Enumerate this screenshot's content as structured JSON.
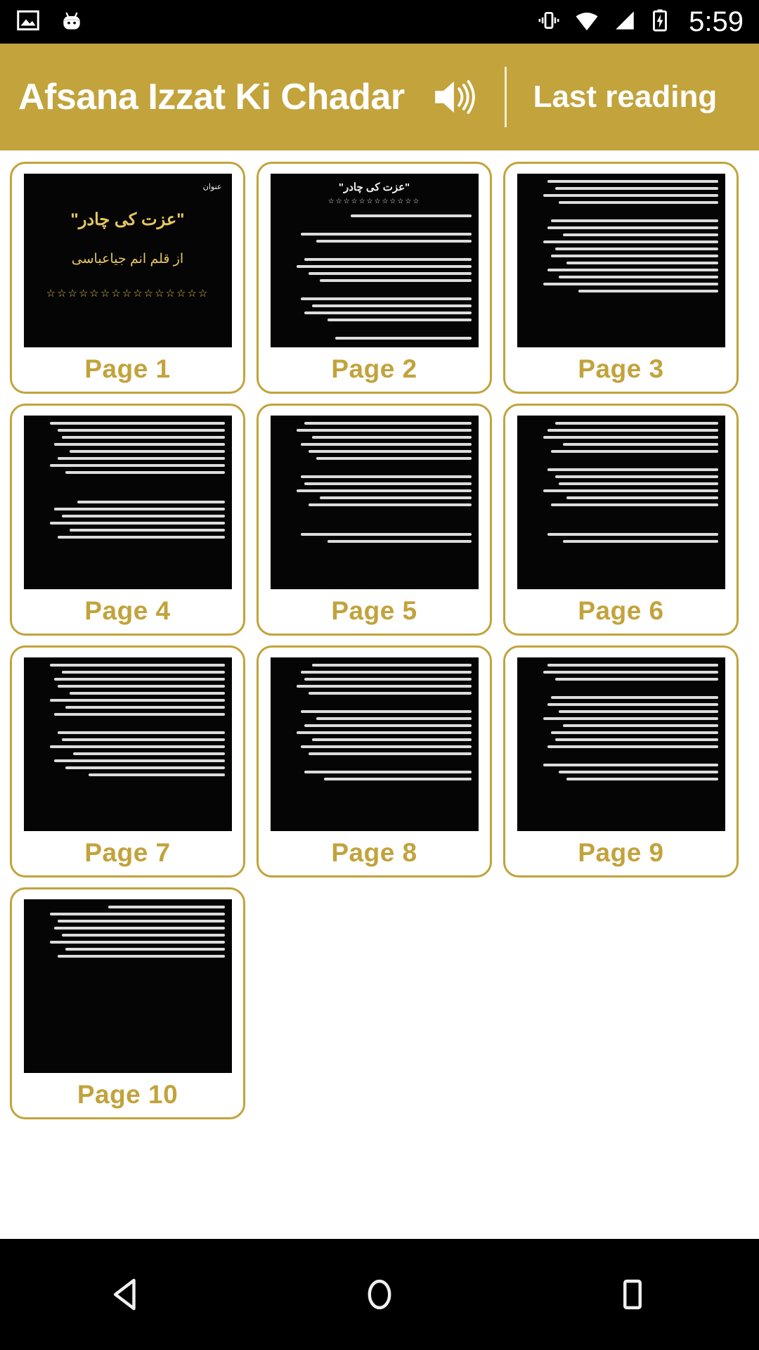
{
  "status_bar": {
    "time": "5:59",
    "icons": [
      "screenshot-icon",
      "android-mascot-icon",
      "vibrate-icon",
      "wifi-icon",
      "signal-icon",
      "battery-charging-icon"
    ]
  },
  "header": {
    "title": "Afsana Izzat Ki Chadar",
    "speaker_icon": "speaker-icon",
    "last_reading_label": "Last reading",
    "background_color": "#c2a33c",
    "text_color": "#ffffff"
  },
  "grid": {
    "accent_color": "#c2a33c",
    "thumb_background": "#050505",
    "pages": [
      {
        "label": "Page 1",
        "kind": "cover",
        "corner_note": "عنوان",
        "title": "\"عزت کی چادر\"",
        "author": "از قلم  انم جیاعباسی",
        "stars": "☆☆☆☆☆☆☆☆☆☆☆☆☆☆☆"
      },
      {
        "label": "Page 2",
        "kind": "titled-text",
        "heading": "\"عزت کی چادر\"",
        "stars": "☆☆☆☆☆☆☆☆☆☆☆☆",
        "line_widths": [
          62,
          0,
          88,
          80,
          0,
          86,
          90,
          84,
          78,
          0,
          88,
          82,
          86,
          74,
          0,
          70
        ]
      },
      {
        "label": "Page 3",
        "kind": "text",
        "line_widths": [
          88,
          84,
          90,
          82,
          0,
          86,
          88,
          80,
          90,
          84,
          86,
          78,
          88,
          82,
          90,
          72
        ]
      },
      {
        "label": "Page 4",
        "kind": "text",
        "line_widths": [
          90,
          86,
          84,
          88,
          80,
          86,
          90,
          82,
          0,
          0,
          76,
          88,
          84,
          90,
          80,
          86
        ]
      },
      {
        "label": "Page 5",
        "kind": "text",
        "line_widths": [
          86,
          90,
          82,
          88,
          84,
          80,
          0,
          88,
          86,
          90,
          78,
          84,
          0,
          0,
          88,
          74
        ]
      },
      {
        "label": "Page 6",
        "kind": "text",
        "line_widths": [
          84,
          88,
          90,
          80,
          86,
          0,
          88,
          84,
          82,
          90,
          78,
          86,
          0,
          0,
          88,
          80
        ]
      },
      {
        "label": "Page 7",
        "kind": "text",
        "line_widths": [
          90,
          84,
          88,
          86,
          80,
          90,
          82,
          88,
          0,
          86,
          84,
          90,
          78,
          88,
          82,
          70
        ]
      },
      {
        "label": "Page 8",
        "kind": "text",
        "line_widths": [
          82,
          88,
          86,
          90,
          84,
          0,
          88,
          80,
          86,
          90,
          82,
          88,
          84,
          0,
          86,
          76
        ]
      },
      {
        "label": "Page 9",
        "kind": "text",
        "line_widths": [
          88,
          90,
          84,
          0,
          86,
          88,
          82,
          90,
          80,
          86,
          84,
          88,
          0,
          90,
          82,
          78
        ]
      },
      {
        "label": "Page 10",
        "kind": "text-cropped",
        "line_widths": [
          60,
          90,
          86,
          88,
          84,
          90,
          82,
          86
        ]
      }
    ]
  },
  "nav_bar": {
    "back_icon": "back-triangle-icon",
    "home_icon": "home-circle-icon",
    "recents_icon": "recents-square-icon",
    "background_color": "#000000"
  }
}
